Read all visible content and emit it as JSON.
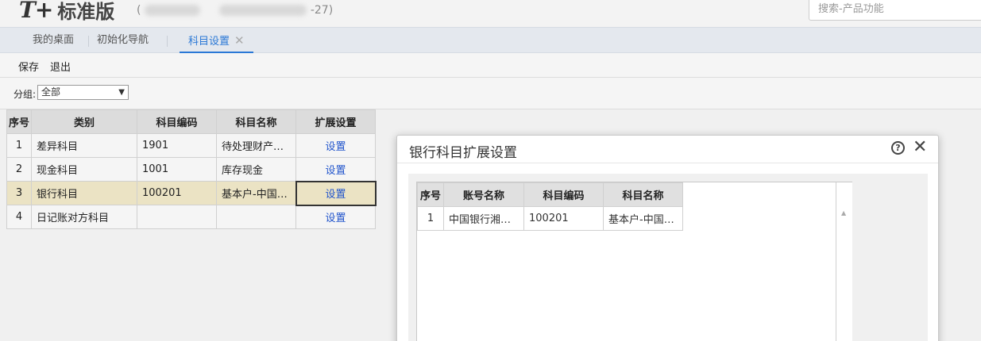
{
  "app": {
    "logo_mark": "T+",
    "logo_text": "标准版",
    "company_prefix": "(",
    "company_suffix": "-27)"
  },
  "search": {
    "placeholder": "搜索-产品功能"
  },
  "tabs": [
    {
      "label": "我的桌面"
    },
    {
      "label": "初始化导航"
    },
    {
      "label": "科目设置",
      "close": "✕"
    }
  ],
  "toolbar": {
    "save": "保存",
    "exit": "退出"
  },
  "filter": {
    "label": "分组:",
    "selected": "全部",
    "arrow": "▼"
  },
  "grid": {
    "headers": [
      "序号",
      "类别",
      "科目编码",
      "科目名称",
      "扩展设置"
    ],
    "rows": [
      {
        "no": "1",
        "category": "差异科目",
        "code": "1901",
        "name": "待处理财产…",
        "action": "设置"
      },
      {
        "no": "2",
        "category": "现金科目",
        "code": "1001",
        "name": "库存现金",
        "action": "设置"
      },
      {
        "no": "3",
        "category": "银行科目",
        "code": "100201",
        "name": "基本户-中国…",
        "action": "设置"
      },
      {
        "no": "4",
        "category": "日记账对方科目",
        "code": "",
        "name": "",
        "action": "设置"
      }
    ]
  },
  "dialog": {
    "title": "银行科目扩展设置",
    "help": "?",
    "close": "✕",
    "headers": [
      "序号",
      "账号名称",
      "科目编码",
      "科目名称"
    ],
    "rows": [
      {
        "no": "1",
        "account": "中国银行湘…",
        "code": "100201",
        "name": "基本户-中国…"
      }
    ],
    "scroll_up": "▲"
  }
}
